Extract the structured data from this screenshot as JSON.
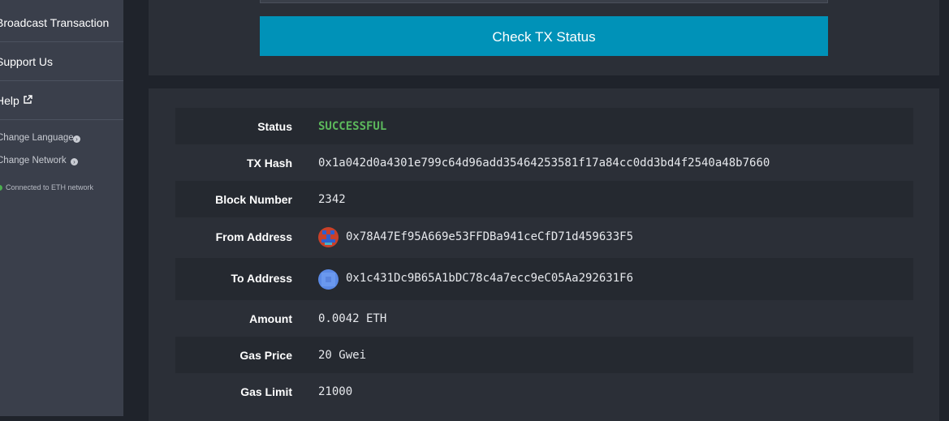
{
  "sidebar": {
    "items": [
      {
        "label": "Broadcast Transaction"
      },
      {
        "label": "Support Us"
      },
      {
        "label": "Help"
      }
    ],
    "settings": [
      {
        "label": "Change Language"
      },
      {
        "label": "Change Network"
      }
    ],
    "network_status": "Connected to ETH network"
  },
  "actions": {
    "check_label": "Check TX Status"
  },
  "tx": {
    "rows": [
      {
        "label": "Status",
        "value": "SUCCESSFUL"
      },
      {
        "label": "TX Hash",
        "value": "0x1a042d0a4301e799c64d96add35464253581f17a84cc0dd3bd4f2540a48b7660"
      },
      {
        "label": "Block Number",
        "value": "2342"
      },
      {
        "label": "From Address",
        "value": "0x78A47Ef95A669e53FFDBa941ceCfD71d459633F5"
      },
      {
        "label": "To Address",
        "value": "0x1c431Dc9B65A1bDC78c4a7ecc9eC05Aa292631F6"
      },
      {
        "label": "Amount",
        "value": "0.0042 ETH"
      },
      {
        "label": "Gas Price",
        "value": "20 Gwei"
      },
      {
        "label": "Gas Limit",
        "value": "21000"
      }
    ]
  },
  "colors": {
    "accent": "#0092b8",
    "success": "#5cb85c",
    "sidebar_bg": "#3a3f4b",
    "panel_bg": "#2b2f37"
  },
  "icons": [
    "external-link-icon",
    "arrow-circle-right-icon",
    "status-dot-icon",
    "identicon"
  ]
}
